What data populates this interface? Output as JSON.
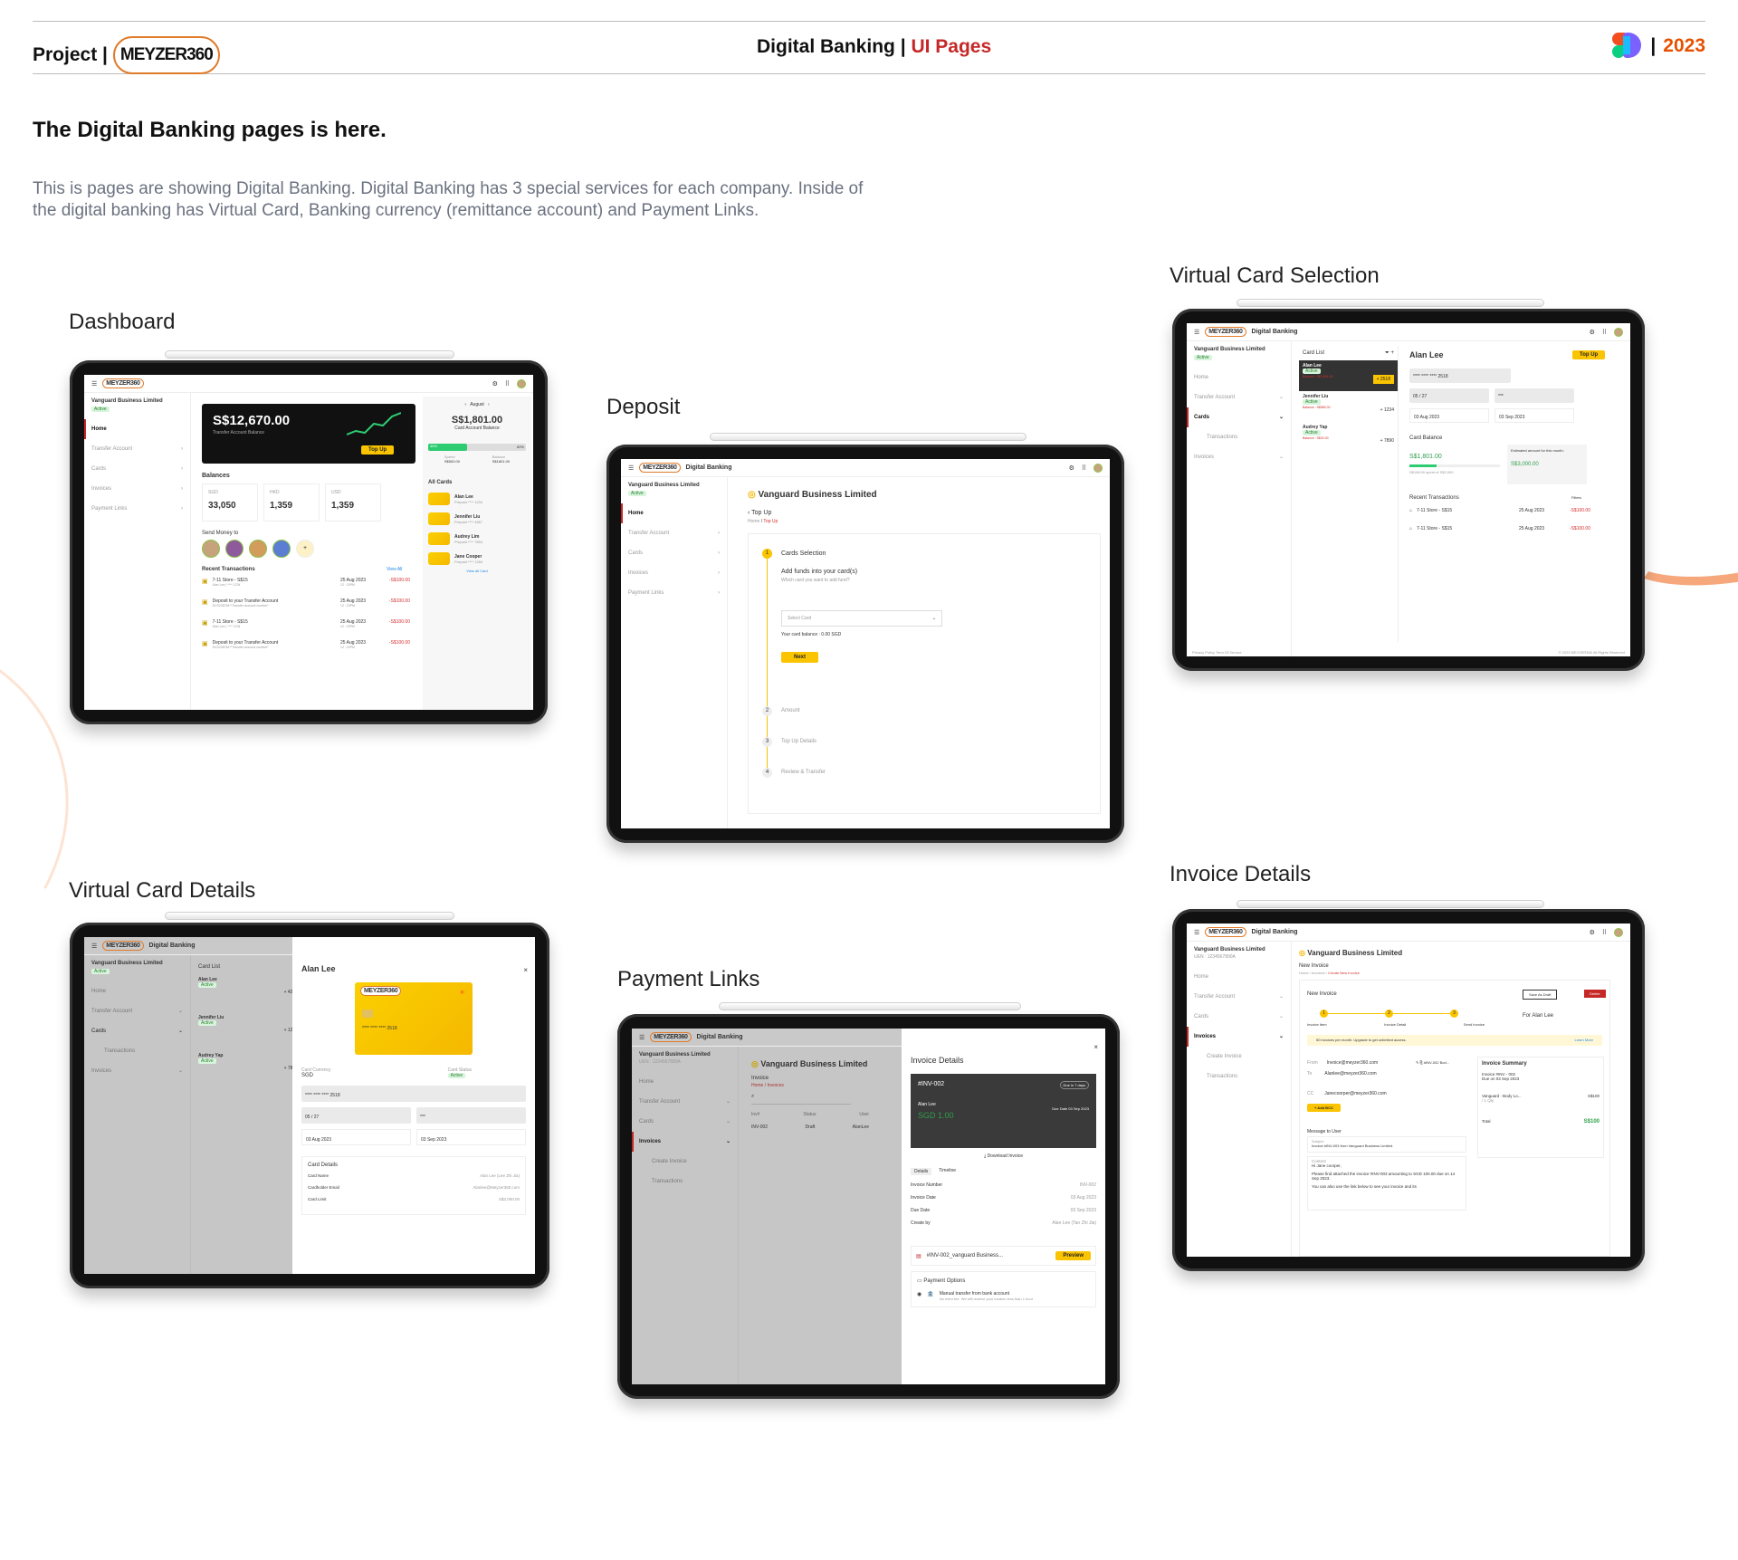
{
  "header": {
    "project_label": "Project |",
    "logo_text": "MEYZER360",
    "title_main": "Digital Banking",
    "title_sep": "|",
    "title_accent": "UI Pages",
    "year_sep": "|",
    "year": "2023"
  },
  "intro": {
    "title": "The Digital Banking pages is here.",
    "text": "This is pages are showing Digital Banking. Digital Banking has 3 special services for each company. Inside of the digital banking has Virtual Card, Banking currency (remittance account) and Payment Links."
  },
  "sections": {
    "dashboard": "Dashboard",
    "deposit": "Deposit",
    "virtual_card_selection": "Virtual Card Selection",
    "virtual_card_details": "Virtual Card Details",
    "payment_links": "Payment Links",
    "invoice_details": "Invoice Details"
  },
  "app": {
    "company": "Vanguard Business Limited",
    "active": "Active",
    "brand": "Digital Banking",
    "nav": [
      "Home",
      "Transfer Account",
      "Cards",
      "Invoices",
      "Payment Links"
    ],
    "nav_cards_sub": "Transactions",
    "nav_inv_sub": [
      "Create Invoice",
      "Transactions"
    ]
  },
  "dashboard": {
    "balance": "S$12,670.00",
    "balance_label": "Transfer Account Balance",
    "topup": "Top Up",
    "balances_title": "Balances",
    "currencies": [
      {
        "code": "SGD",
        "value": "33,050"
      },
      {
        "code": "HKD",
        "value": "1,359"
      },
      {
        "code": "USD",
        "value": "1,359"
      }
    ],
    "send_money": "Send Money to",
    "recent": "Recent Transactions",
    "view_all": "View All",
    "transactions": [
      {
        "name": "7-11 Store - S$15",
        "sub": "Alan Lee | **** 1234",
        "date": "25 Aug 2023",
        "time": "12 : 20PM",
        "amount": "-S$100.00"
      },
      {
        "name": "Deposit to your Transfer Account",
        "sub": "DXS238764**Transfer account number*",
        "date": "25 Aug 2023",
        "time": "12 : 20PM",
        "amount": "-S$100.00"
      },
      {
        "name": "7-11 Store - S$15",
        "sub": "Alan Lee | **** 1234",
        "date": "25 Aug 2023",
        "time": "12 : 20PM",
        "amount": "-S$100.00"
      },
      {
        "name": "Deposit to your Transfer Account",
        "sub": "DXS238764**Transfer account number*",
        "date": "25 Aug 2023",
        "time": "12 : 20PM",
        "amount": "-S$100.00"
      }
    ],
    "month": "August",
    "card_balance": "S$1,801.00",
    "card_balance_label": "Card Account Balance",
    "pct_left": "40%",
    "pct_right": "60%",
    "spend_label": "Spend",
    "spend_value": "S$500.00",
    "bal_label": "Balance",
    "bal_value": "S$1801.00",
    "all_cards": "All Cards",
    "cards": [
      {
        "name": "Alan Lee",
        "num": "Prepaid **** 1234"
      },
      {
        "name": "Jennifer Liu",
        "num": "Prepaid **** 4567"
      },
      {
        "name": "Audrey Lim",
        "num": "Prepaid **** 7894"
      },
      {
        "name": "Jane Cooper",
        "num": "Prepaid **** 1284"
      }
    ],
    "view_all_card": "View all Card"
  },
  "deposit": {
    "back": "Top Up",
    "crumb_home": "Home",
    "crumb_cur": "Top Up",
    "steps": [
      "Cards Selection",
      "Amount",
      "Top Up Details",
      "Review & Transfer"
    ],
    "add_funds": "Add funds into your card(s)",
    "which": "Which card you want to add fund?",
    "select_placeholder": "Select Card",
    "card_balance": "Your card balance : 0.00 SGD",
    "next": "Next"
  },
  "vcs": {
    "card_list": "Card List",
    "holder": "Alan Lee",
    "topup": "Top Up",
    "list": [
      {
        "name": "Alan Lee",
        "amount": "+ 2518",
        "bal": "Balance : S$1,801.00"
      },
      {
        "name": "Jennifer Liu",
        "amount": "+ 1234",
        "bal": "Balance : S$580.00"
      },
      {
        "name": "Audrey Yap",
        "amount": "+ 7890",
        "bal": "Balance : S$20.00"
      }
    ],
    "card_number": "**** **** **** 2518",
    "expiry": "05 / 27",
    "cvv": "***",
    "active_date": "03 Aug 2023",
    "expire_date": "03 Sep 2023",
    "card_balance_title": "Card Balance",
    "card_balance": "S$1,801.00",
    "spent": "S$198.00 spent of S$2,000",
    "estimated": "Estimated amount for this month:",
    "estimated_value": "S$3,000.00",
    "recent": "Recent Transactions",
    "filters": "Filters",
    "tx": [
      {
        "name": "7-11 Store - S$15",
        "date": "25 Aug 2023",
        "amount": "-S$100.00"
      },
      {
        "name": "7-11 Store - S$15",
        "date": "25 Aug 2023",
        "amount": "-S$100.00"
      }
    ],
    "footer_left": "Privacy Policy   Term Of Service",
    "footer_right": "© 2023 MEYZER360 All Rights Reserved"
  },
  "vcd": {
    "holder": "Alan Lee",
    "card_list": "Card List",
    "list": [
      {
        "name": "Alan Lee",
        "amount": "+ 4295"
      },
      {
        "name": "Jennifer Liu",
        "amount": "+ 1234"
      },
      {
        "name": "Audrey Yap",
        "amount": "+ 7894"
      }
    ],
    "card_brand": "MEYZER360",
    "card_digits": "**** **** **** 2518",
    "currency_label": "Card Currency",
    "currency": "SGD",
    "status_label": "Card Status",
    "status": "Active",
    "number": "**** **** **** 2518",
    "expiry": "05 / 27",
    "cvv": "***",
    "active_date": "03 Aug 2023",
    "expire_date": "03 Sep 2023",
    "details_title": "Card Details",
    "rows": [
      {
        "k": "Card Name",
        "v": "Alan Lee (Lee Zhi Jia)"
      },
      {
        "k": "Cardholder Email",
        "v": "Alanlee@Meyzer360.com"
      },
      {
        "k": "Card Limit",
        "v": "S$2,000.00"
      }
    ]
  },
  "pl": {
    "uen": "UEN : 1234567890A",
    "page": "Invoice",
    "crumb": "Home  /  Invoices",
    "cols": [
      "Inv#",
      "Status",
      "User"
    ],
    "row": [
      "INV-002",
      "Draft",
      "AlanLee"
    ],
    "panel_title": "Invoice Details",
    "inv_no": "#INV-002",
    "due_chip": "Due in 7 days",
    "name": "Alan Lee",
    "due_date": "Due Date 03 Sep 2023",
    "amount": "SGD 1.00",
    "download": "Download Invoice",
    "tabs": [
      "Details",
      "Timeline"
    ],
    "rows": [
      {
        "k": "Invoice Number",
        "v": "INV-002"
      },
      {
        "k": "Invoice Date",
        "v": "03 Aug 2023"
      },
      {
        "k": "Due Date",
        "v": "03 Sep 2023"
      },
      {
        "k": "Create by",
        "v": "Alan Lee (Tan Zhi Jia)"
      }
    ],
    "file": "#INV-002_vanguard Business...",
    "preview": "Preview",
    "payment_options": "Payment Options",
    "manual": "Manual transfer from bank account",
    "manual_sub": "No extra fee. We will receive your fundion less than 1 hour"
  },
  "inv": {
    "uen": "UEN : 1234567890A",
    "title": "New Invoice",
    "crumb_a": "Home  /  Invoices  /",
    "crumb_b": "Create New Invoice",
    "save_draft": "Save As Draft",
    "delete": "Delete",
    "steps": [
      "Invoice Item",
      "Invoice Detail",
      "Send Invoice"
    ],
    "for": "For Alan Lee",
    "notice": "50 invoices per month. Upgrade to get unlimited access.",
    "learn": "Learn More",
    "from_label": "From",
    "from": "Invoice@meyzer360.com",
    "to_label": "To",
    "to": "Alanlee@meyzer360.com",
    "attach": "#INV-002 Bod...",
    "cc_label": "CC",
    "cc": "Janecoorper@meyzer360.com",
    "add_bcc": "+ Add BCC",
    "msg_title": "Message to User",
    "subject_label": "Subject",
    "subject": "Invoice #INV-003 from Vanguard Business Limited.",
    "content_label": "Content",
    "content_1": "Hi Jane coorper,",
    "content_2": "Please find attached the invoice #INV-003 amounting to SGD 100.00 due on 14 Sep 2023.",
    "content_3": "You can also use the link below to see your invoice and its",
    "summary_title": "Invoice Summary",
    "summary_inv": "Invoice #INV - 002",
    "summary_due": "Due on 03 Sep 2023",
    "summary_item": "Vanguard - Body Lo...",
    "summary_qty": "/ 1 Qty",
    "summary_item_amt": "S$100",
    "total_label": "Total",
    "total": "S$100"
  }
}
